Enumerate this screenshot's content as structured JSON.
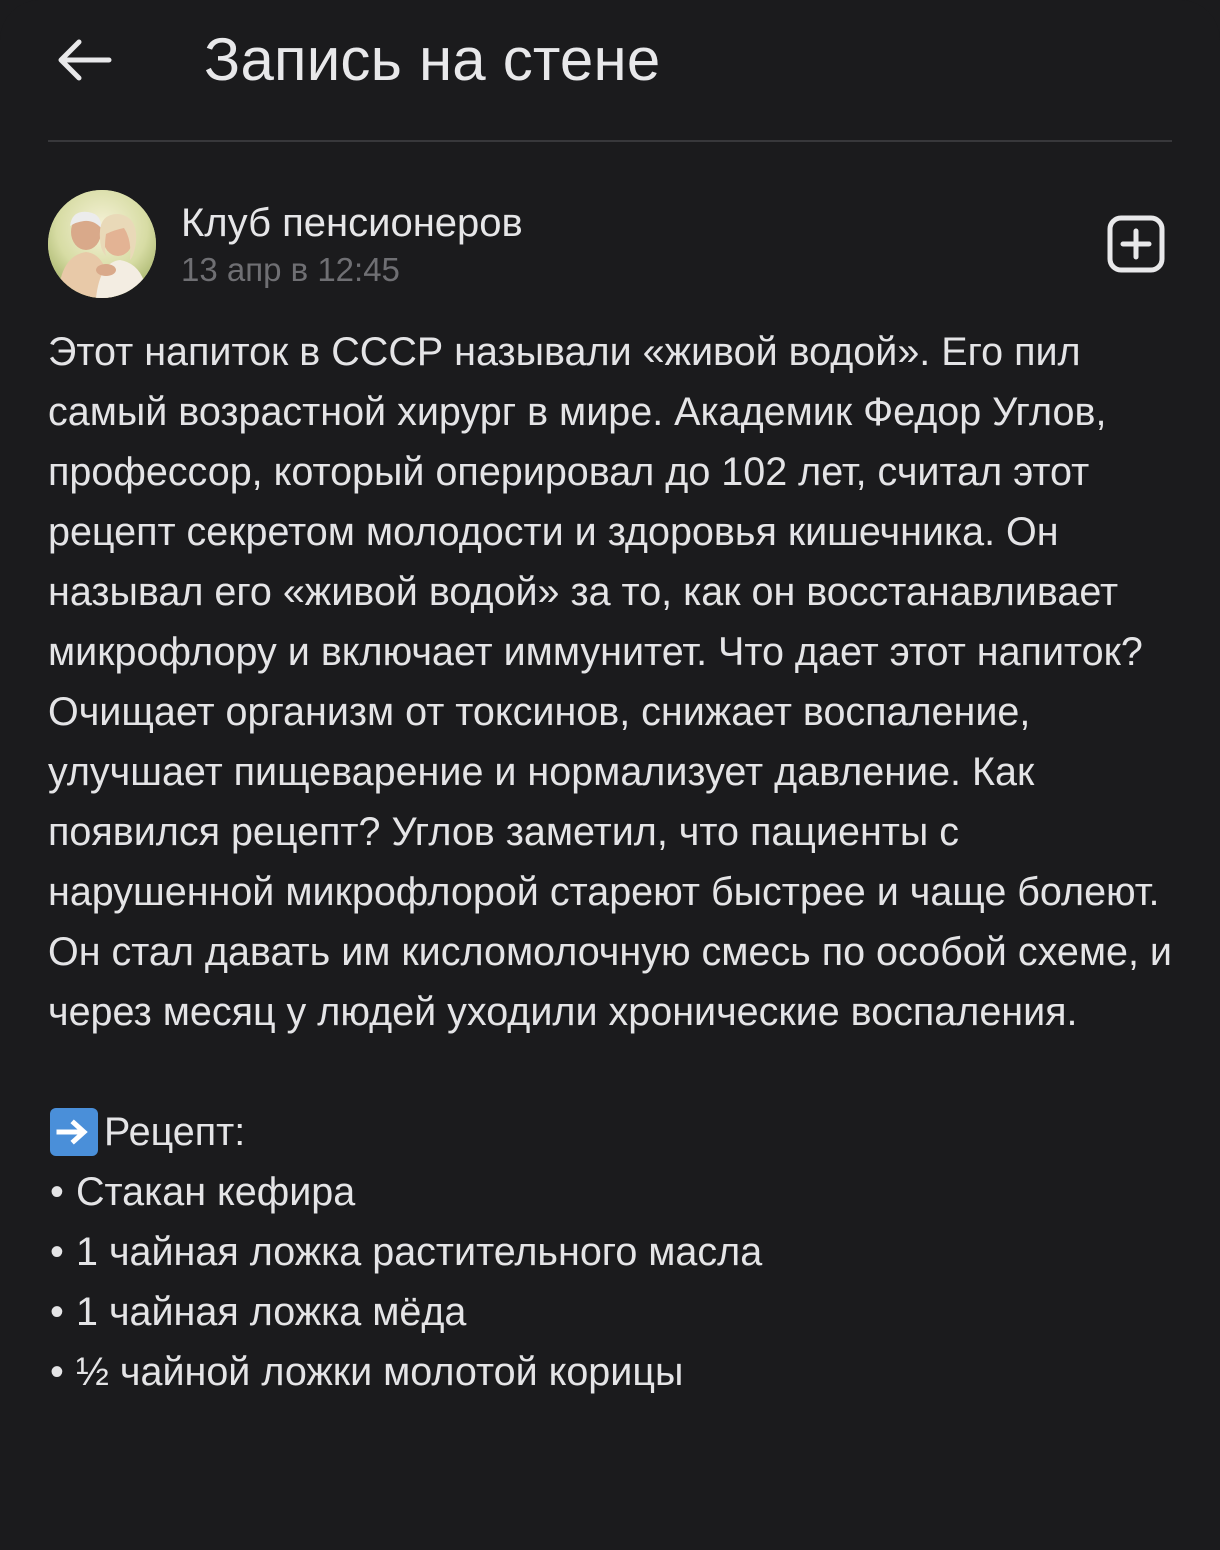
{
  "header": {
    "back_icon": "arrow-left-icon",
    "title": "Запись на стене"
  },
  "post": {
    "author": "Клуб пенсионеров",
    "date": "13 апр в 12:45",
    "avatar_icon": "group-avatar-photo",
    "add_icon": "plus-square-icon",
    "text": "Этот напиток в СССР называли «живой водой». Его пил самый возрастной хирург в мире. Академик Федор Углов, профессор, который оперировал до 102 лет, считал этот рецепт секретом молодости и здоровья кишечника. Он называл его «живой водой» за то, как он восстанавливает микрофлору и включает иммунитет. Что дает этот напиток? Очищает организм от токсинов, снижает воспаление, улучшает пищеварение и нормализует давление. Как появился рецепт? Углов заметил, что пациенты с нарушенной микрофлорой стареют быстрее и чаще болеют. Он стал давать им кисломолочную смесь по особой схеме, и через месяц у людей уходили хронические воспаления.",
    "recipe_icon": "arrow-right-emoji-icon",
    "recipe_title": "Рецепт:",
    "bullet": "•",
    "recipe_items": [
      "Стакан кефира",
      "1 чайная ложка растительного масла",
      "1 чайная ложка мёда",
      "½ чайной ложки молотой корицы"
    ]
  },
  "colors": {
    "background": "#1b1b1d",
    "text": "#e4e4e6",
    "muted": "#6f6f73",
    "divider": "#38383b",
    "emoji_blue": "#4a8fd9"
  }
}
